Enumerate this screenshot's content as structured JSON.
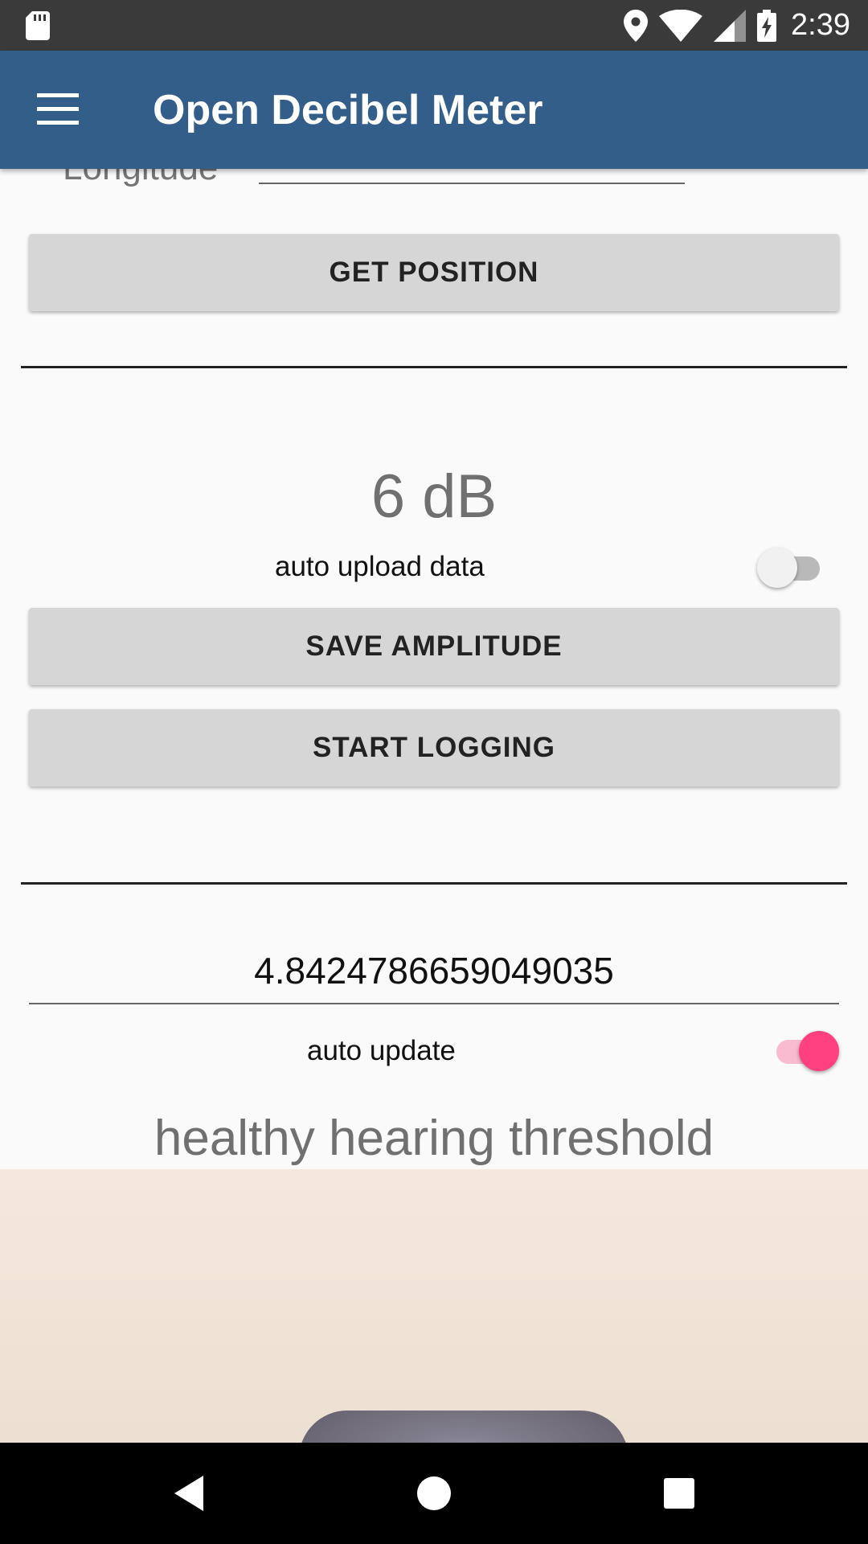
{
  "status_bar": {
    "time": "2:39",
    "icons": [
      "sd-card-icon",
      "location-icon",
      "wifi-icon",
      "signal-icon",
      "battery-charging-icon"
    ]
  },
  "app_bar": {
    "title": "Open Decibel Meter",
    "menu_icon": "hamburger-menu-icon"
  },
  "location": {
    "longitude_label": "Longitude",
    "longitude_value": "",
    "get_position_label": "GET POSITION"
  },
  "amplitude": {
    "value": "6 dB",
    "auto_upload_label": "auto upload data",
    "auto_upload_enabled": false,
    "save_label": "SAVE AMPLITUDE",
    "logging_label": "START LOGGING"
  },
  "threshold": {
    "value": "4.8424786659049035",
    "auto_update_label": "auto update",
    "auto_update_enabled": true,
    "description": "healthy hearing threshold"
  },
  "colors": {
    "app_bar": "#345e8a",
    "accent": "#ff4081",
    "accent_track": "#f8bbd0",
    "button": "#d6d6d6"
  },
  "navigation": {
    "back_icon": "back-triangle-icon",
    "home_icon": "home-circle-icon",
    "recents_icon": "recents-square-icon"
  }
}
